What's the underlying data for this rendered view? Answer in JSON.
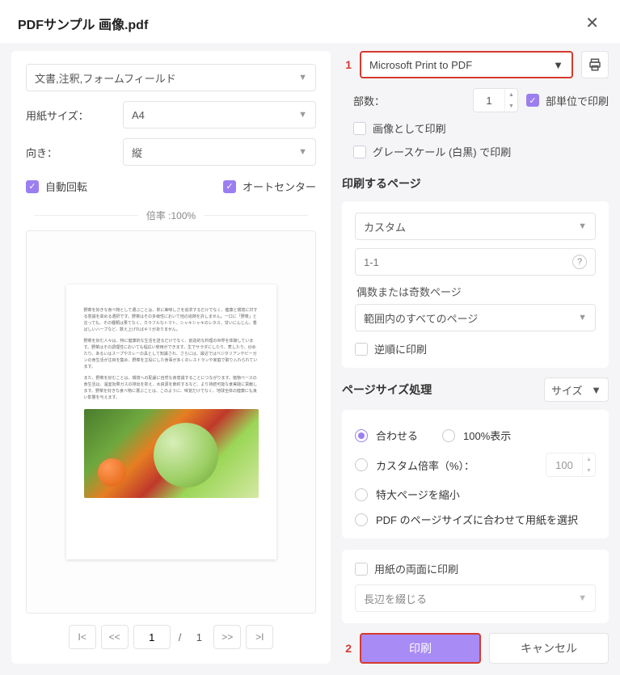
{
  "title": "PDFサンプル 画像.pdf",
  "left": {
    "content_type": "文書,注釈,フォームフィールド",
    "paper_size_label": "用紙サイズ：",
    "paper_size_value": "A4",
    "orientation_label": "向き：",
    "orientation_value": "縦",
    "auto_rotate": "自動回転",
    "auto_center": "オートセンター",
    "zoom_label": "倍率 :100%",
    "pager": {
      "current": "1",
      "total": "1"
    }
  },
  "right": {
    "marker1": "1",
    "printer": "Microsoft Print to PDF",
    "copies_label": "部数：",
    "copies_value": "1",
    "collate": "部単位で印刷",
    "print_as_image": "画像として印刷",
    "grayscale": "グレースケール (白黒) で印刷",
    "pages_title": "印刷するページ",
    "pages_mode": "カスタム",
    "pages_range": "1-1",
    "odd_even_label": "偶数または奇数ページ",
    "odd_even_value": "範囲内のすべてのページ",
    "reverse": "逆順に印刷",
    "size_title": "ページサイズ処理",
    "size_mode": "サイズ",
    "radios": {
      "fit": "合わせる",
      "actual": "100%表示",
      "custom_scale": "カスタム倍率（%）：",
      "custom_scale_val": "100",
      "shrink": "特大ページを縮小",
      "choose_paper": "PDF のページサイズに合わせて用紙を選択"
    },
    "duplex": "用紙の両面に印刷",
    "binding": "長辺を綴じる",
    "marker2": "2",
    "print_btn": "印刷",
    "cancel_btn": "キャンセル"
  }
}
